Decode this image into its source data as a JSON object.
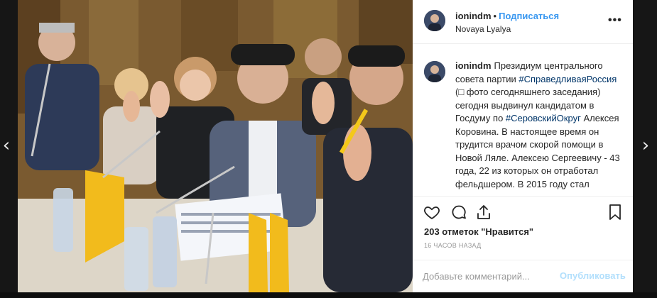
{
  "navigation": {
    "prev_arrow": "‹",
    "next_arrow": "›"
  },
  "post": {
    "username": "ionindm",
    "separator": "•",
    "follow_label": "Подписаться",
    "location": "Novaya Lyalya",
    "more_icon": "•••",
    "caption": {
      "username": "ionindm",
      "text_1": "Президиум центрального совета партии ",
      "hashtag_1": "#СправедливаяРоссия",
      "text_2": " (□ фото сегодняшнего заседания) сегодня выдвинул кандидатом в Госдуму по ",
      "hashtag_2": "#СеровскийОкруг",
      "text_3": " Алексея Коровина. В настоящее время он трудится врачом скорой помощи в Новой Ляле. Алексею Сергеевичу - 43 года, 22 из которых он отработал фельдшером. В 2015 году стал"
    },
    "likes": "203 отметок \"Нравится\"",
    "time": "16 часов назад",
    "comment_placeholder": "Добавьте комментарий...",
    "publish_label": "Опубликовать",
    "icons": {
      "like": "heart-icon",
      "comment": "comment-icon",
      "share": "share-icon",
      "save": "bookmark-icon"
    }
  },
  "colors": {
    "link_blue": "#3897f0",
    "hashtag": "#003569",
    "publish_disabled": "#b2dffc",
    "text": "#262626",
    "muted": "#999999"
  }
}
